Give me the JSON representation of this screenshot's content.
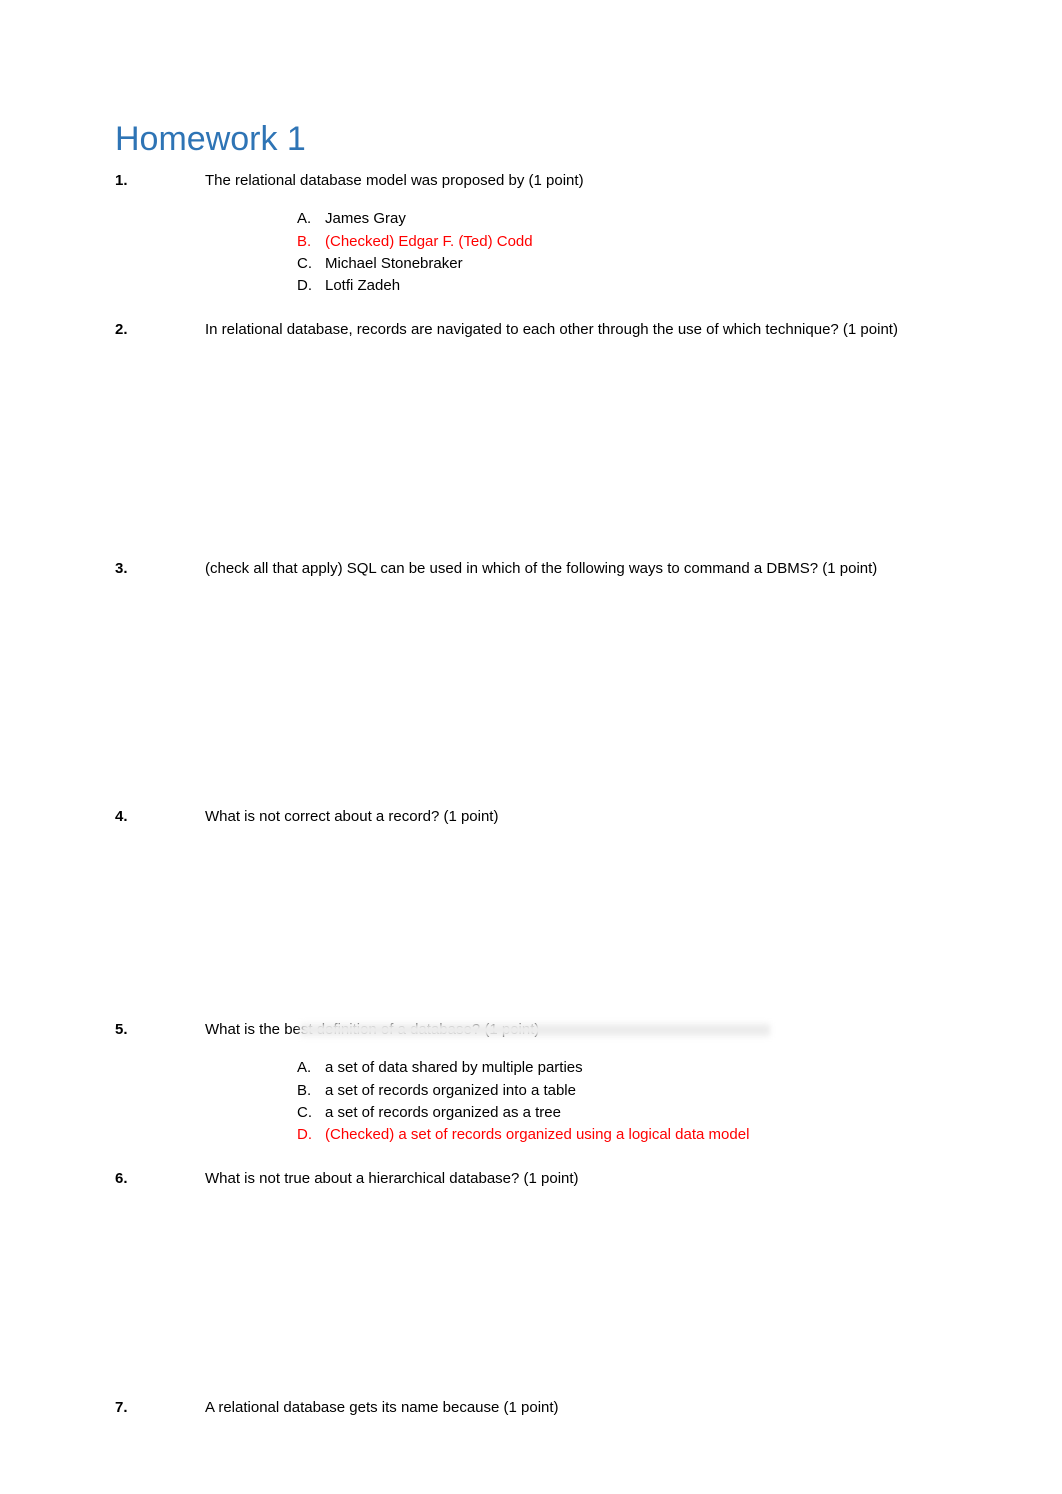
{
  "title": "Homework 1",
  "questions": {
    "q1": {
      "num": "1.",
      "text": "The relational database model was proposed by (1 point)",
      "opts": {
        "a": {
          "letter": "A.",
          "text": "James Gray"
        },
        "b": {
          "letter": "B.",
          "text": "(Checked) Edgar F. (Ted) Codd"
        },
        "c": {
          "letter": "C.",
          "text": "Michael Stonebraker"
        },
        "d": {
          "letter": "D.",
          "text": "Lotfi Zadeh"
        }
      }
    },
    "q2": {
      "num": "2.",
      "text": "In relational database, records are navigated to each other through the use of which technique? (1 point)"
    },
    "q3": {
      "num": "3.",
      "text": "(check all that apply) SQL can be used in which of the following ways to command a DBMS? (1 point)"
    },
    "q4": {
      "num": "4.",
      "text": "What is not correct about a record? (1 point)"
    },
    "q5": {
      "num": "5.",
      "text": "What is the best definition of a database? (1 point)",
      "opts": {
        "a": {
          "letter": "A.",
          "text": "a set of data shared by multiple parties"
        },
        "b": {
          "letter": "B.",
          "text": "a set of records organized into a table"
        },
        "c": {
          "letter": "C.",
          "text": "a set of records organized as a tree"
        },
        "d": {
          "letter": "D.",
          "text": "(Checked) a set of records organized using a logical data model"
        }
      }
    },
    "q6": {
      "num": "6.",
      "text": "What is not true about a hierarchical database? (1 point)"
    },
    "q7": {
      "num": "7.",
      "text": "A relational database gets its name because (1 point)"
    }
  }
}
